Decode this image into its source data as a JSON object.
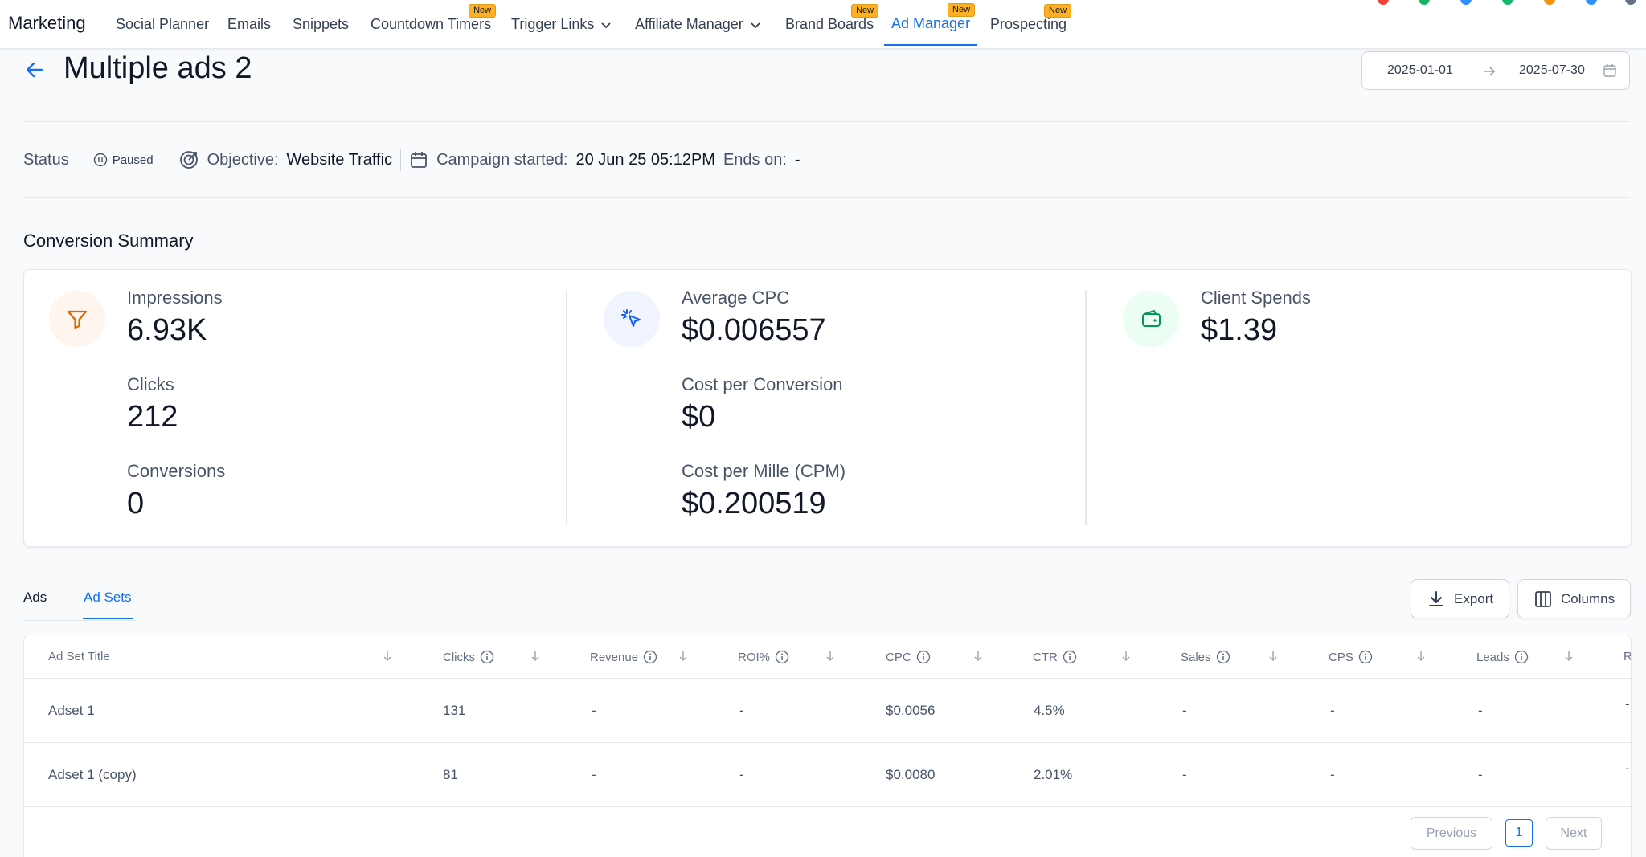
{
  "nav": {
    "brand": "Marketing",
    "items": [
      {
        "label": "Social Planner"
      },
      {
        "label": "Emails"
      },
      {
        "label": "Snippets"
      },
      {
        "label": "Countdown Timers",
        "badge": "New"
      },
      {
        "label": "Trigger Links"
      },
      {
        "label": "Affiliate Manager"
      },
      {
        "label": "Brand Boards",
        "badge": "New"
      },
      {
        "label": "Ad Manager",
        "badge": "New"
      },
      {
        "label": "Prospecting",
        "badge": "New"
      }
    ]
  },
  "header": {
    "title": "Multiple ads 2",
    "date_start": "2025-01-01",
    "date_end": "2025-07-30"
  },
  "status": {
    "label": "Status",
    "value": "Paused",
    "objective_label": "Objective:",
    "objective_value": "Website Traffic",
    "started_label": "Campaign started:",
    "started_value": "20 Jun 25 05:12PM",
    "ends_label": "Ends on:",
    "ends_value": "-"
  },
  "summary": {
    "title": "Conversion Summary",
    "impressions_label": "Impressions",
    "impressions_value": "6.93K",
    "clicks_label": "Clicks",
    "clicks_value": "212",
    "conversions_label": "Conversions",
    "conversions_value": "0",
    "avg_cpc_label": "Average CPC",
    "avg_cpc_value": "$0.006557",
    "cost_per_conv_label": "Cost per Conversion",
    "cost_per_conv_value": "$0",
    "cpm_label": "Cost per Mille (CPM)",
    "cpm_value": "$0.200519",
    "spend_label": "Client Spends",
    "spend_value": "$1.39"
  },
  "tabs": {
    "ads": "Ads",
    "adsets": "Ad Sets"
  },
  "buttons": {
    "export": "Export",
    "columns": "Columns"
  },
  "table": {
    "columns": [
      "Ad Set Title",
      "Clicks",
      "Revenue",
      "ROI%",
      "CPC",
      "CTR",
      "Sales",
      "CPS",
      "Leads",
      "R"
    ],
    "rows": [
      [
        "Adset 1",
        "131",
        "-",
        "-",
        "$0.0056",
        "4.5%",
        "-",
        "-",
        "-",
        "-"
      ],
      [
        "Adset 1 (copy)",
        "81",
        "-",
        "-",
        "$0.0080",
        "2.01%",
        "-",
        "-",
        "-",
        "-"
      ]
    ]
  },
  "pager": {
    "previous": "Previous",
    "page": "1",
    "next": "Next"
  }
}
